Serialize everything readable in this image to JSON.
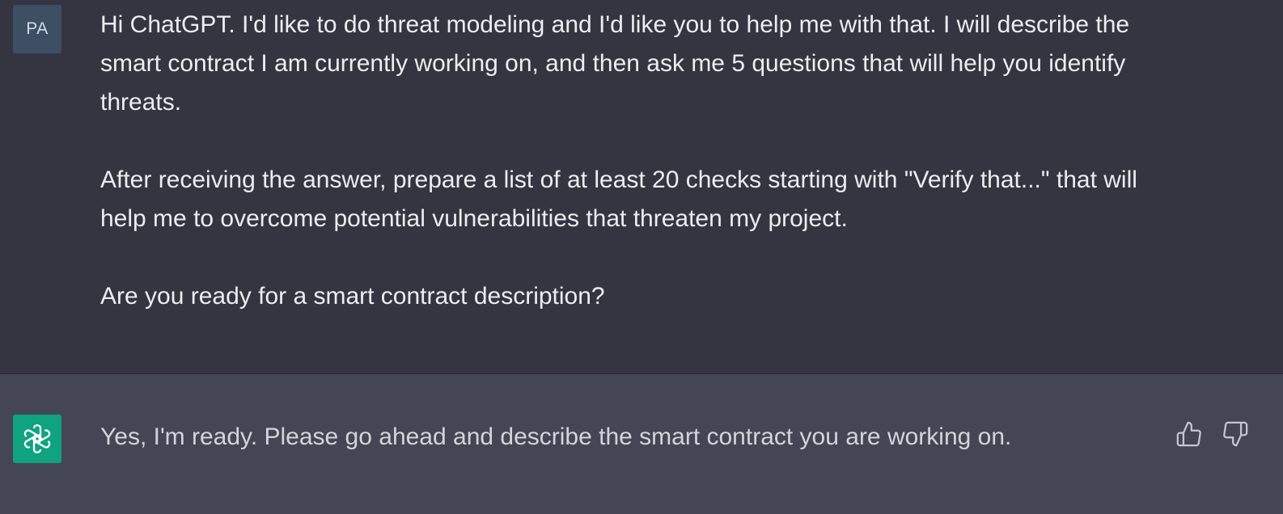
{
  "user_message": {
    "avatar_initials": "PA",
    "paragraphs": [
      "Hi ChatGPT. I'd like to do threat modeling and I'd like you to help me with that. I will describe the smart contract I am currently working on, and then ask me 5 questions that will help you identify threats.",
      "After receiving the answer, prepare a list of at least 20 checks starting with \"Verify that...\" that will help me to overcome potential vulnerabilities that threaten my project.",
      "Are you ready for a smart contract description?"
    ]
  },
  "assistant_message": {
    "avatar_icon": "openai-logo-icon",
    "text": "Yes, I'm ready. Please go ahead and describe the smart contract you are working on.",
    "feedback_icons": [
      "thumbs-up-icon",
      "thumbs-down-icon"
    ]
  },
  "colors": {
    "user_background": "#343541",
    "assistant_background": "#444654",
    "bot_avatar": "#10a37f",
    "user_avatar": "#3d4f62"
  }
}
